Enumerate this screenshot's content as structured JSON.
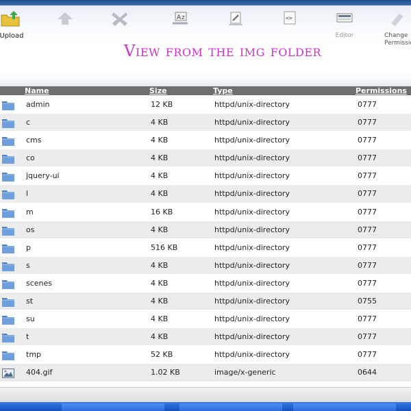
{
  "toolbar": {
    "items": [
      {
        "label": "Upload",
        "icon": "upload-icon",
        "faded": false
      },
      {
        "label": "",
        "icon": "download-icon",
        "faded": true
      },
      {
        "label": "",
        "icon": "delete-icon",
        "faded": true
      },
      {
        "label": "",
        "icon": "rename-icon",
        "faded": true
      },
      {
        "label": "",
        "icon": "edit-icon",
        "faded": true
      },
      {
        "label": "",
        "icon": "code-editor-icon",
        "faded": true
      },
      {
        "label": "Editor",
        "icon": "html-editor-icon",
        "faded": true
      },
      {
        "label": "Change Permission",
        "icon": "permission-icon",
        "faded": true
      }
    ]
  },
  "page": {
    "title": "View from the img folder"
  },
  "table": {
    "headers": {
      "name": "Name",
      "size": "Size",
      "type": "Type",
      "permissions": "Permissions"
    },
    "rows": [
      {
        "icon": "folder-icon",
        "name": "admin",
        "size": "12 KB",
        "type": "httpd/unix-directory",
        "perm": "0777"
      },
      {
        "icon": "folder-icon",
        "name": "c",
        "size": "4 KB",
        "type": "httpd/unix-directory",
        "perm": "0777"
      },
      {
        "icon": "folder-icon",
        "name": "cms",
        "size": "4 KB",
        "type": "httpd/unix-directory",
        "perm": "0777"
      },
      {
        "icon": "folder-icon",
        "name": "co",
        "size": "4 KB",
        "type": "httpd/unix-directory",
        "perm": "0777"
      },
      {
        "icon": "folder-icon",
        "name": "jquery-ui",
        "size": "4 KB",
        "type": "httpd/unix-directory",
        "perm": "0777"
      },
      {
        "icon": "folder-icon",
        "name": "l",
        "size": "4 KB",
        "type": "httpd/unix-directory",
        "perm": "0777"
      },
      {
        "icon": "folder-icon",
        "name": "m",
        "size": "16 KB",
        "type": "httpd/unix-directory",
        "perm": "0777"
      },
      {
        "icon": "folder-icon",
        "name": "os",
        "size": "4 KB",
        "type": "httpd/unix-directory",
        "perm": "0777"
      },
      {
        "icon": "folder-icon",
        "name": "p",
        "size": "516 KB",
        "type": "httpd/unix-directory",
        "perm": "0777"
      },
      {
        "icon": "folder-icon",
        "name": "s",
        "size": "4 KB",
        "type": "httpd/unix-directory",
        "perm": "0777"
      },
      {
        "icon": "folder-icon",
        "name": "scenes",
        "size": "4 KB",
        "type": "httpd/unix-directory",
        "perm": "0777"
      },
      {
        "icon": "folder-icon",
        "name": "st",
        "size": "4 KB",
        "type": "httpd/unix-directory",
        "perm": "0755"
      },
      {
        "icon": "folder-icon",
        "name": "su",
        "size": "4 KB",
        "type": "httpd/unix-directory",
        "perm": "0777"
      },
      {
        "icon": "folder-icon",
        "name": "t",
        "size": "4 KB",
        "type": "httpd/unix-directory",
        "perm": "0777"
      },
      {
        "icon": "folder-icon",
        "name": "tmp",
        "size": "52 KB",
        "type": "httpd/unix-directory",
        "perm": "0777"
      },
      {
        "icon": "image-file-icon",
        "name": "404.gif",
        "size": "1.02 KB",
        "type": "image/x-generic",
        "perm": "0644"
      }
    ]
  },
  "colors": {
    "title": "#cc33cc",
    "header_bg": "#6e6e6e",
    "row_alt": "#ececec",
    "folder": "#5b8fcf",
    "taskbar": "#245edb"
  }
}
